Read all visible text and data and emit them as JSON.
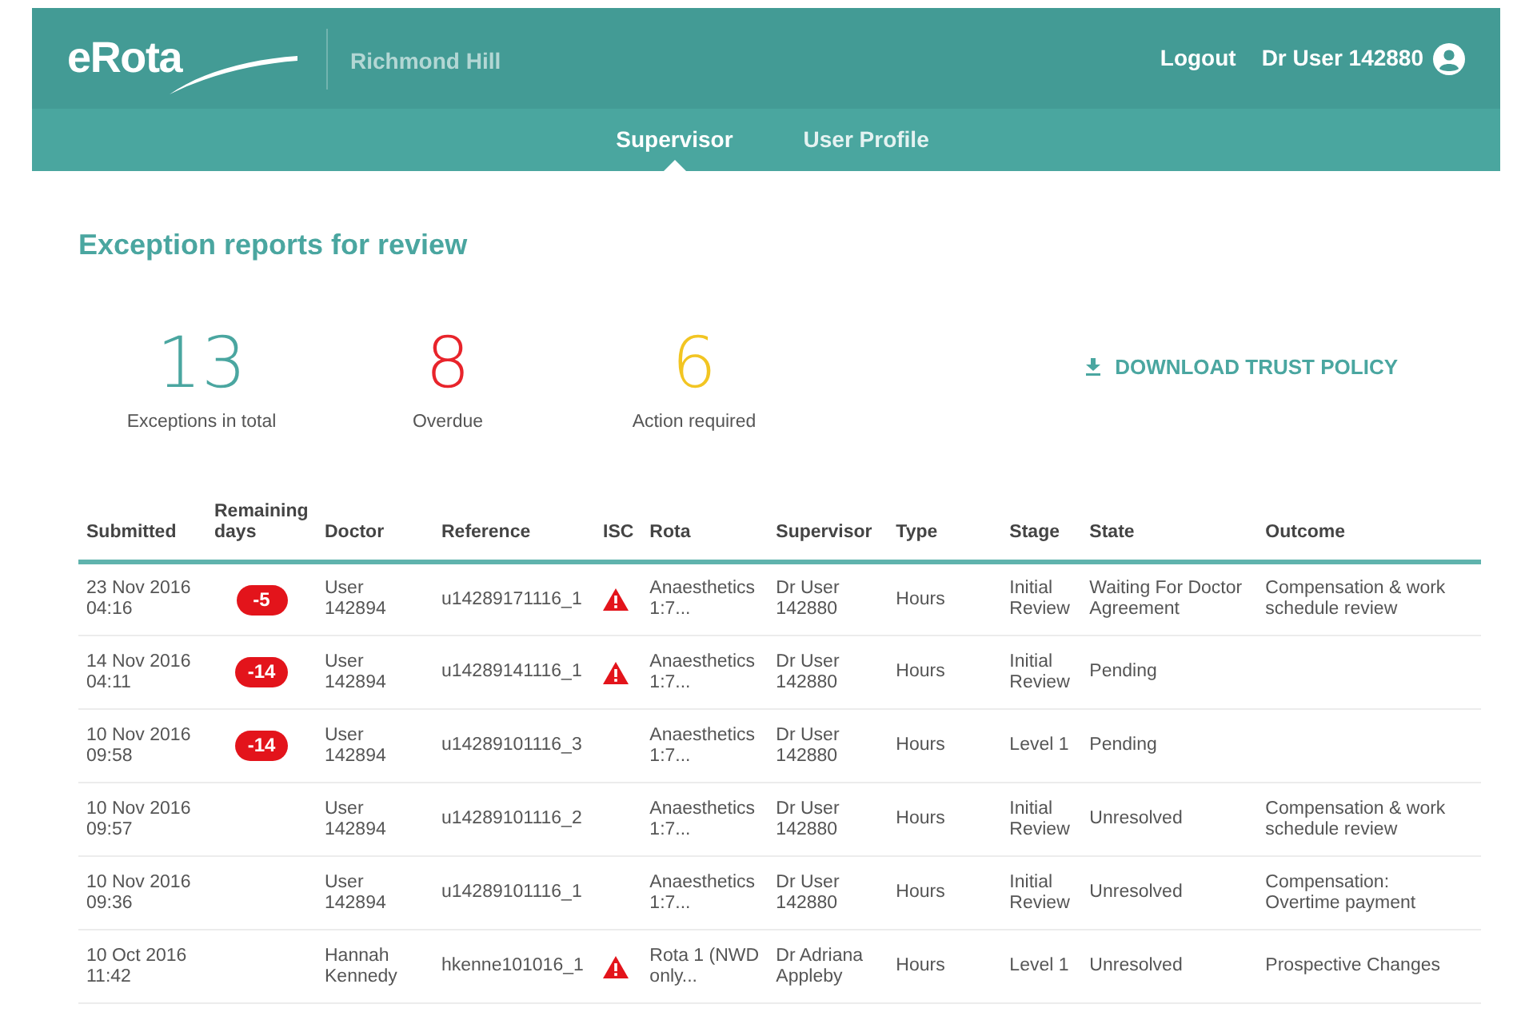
{
  "header": {
    "logo": "eRota",
    "site": "Richmond Hill",
    "logout": "Logout",
    "user": "Dr User 142880"
  },
  "tabs": [
    {
      "label": "Supervisor",
      "selected": true
    },
    {
      "label": "User Profile",
      "selected": false
    }
  ],
  "page_title": "Exception reports for review",
  "stats": [
    {
      "value": "13",
      "label": "Exceptions in total",
      "color": "#4aa6a0"
    },
    {
      "value": "8",
      "label": "Overdue",
      "color": "#e8242b"
    },
    {
      "value": "6",
      "label": "Action required",
      "color": "#f2c522"
    }
  ],
  "download": "DOWNLOAD TRUST POLICY",
  "table": {
    "columns": [
      "Submitted",
      "Remaining\ndays",
      "Doctor",
      "Reference",
      "ISC",
      "Rota",
      "Supervisor",
      "Type",
      "Stage",
      "State",
      "Outcome"
    ],
    "rows": [
      {
        "submitted": "23 Nov 2016\n04:16",
        "remaining": "-5",
        "doctor": "User\n142894",
        "reference": "u14289171116_1",
        "isc": true,
        "rota": "Anaesthetics\n1:7...",
        "supervisor": "Dr User\n142880",
        "type": "Hours",
        "stage": "Initial\nReview",
        "state": "Waiting For Doctor\nAgreement",
        "outcome": "Compensation & work\nschedule review"
      },
      {
        "submitted": "14 Nov 2016\n04:11",
        "remaining": "-14",
        "doctor": "User\n142894",
        "reference": "u14289141116_1",
        "isc": true,
        "rota": "Anaesthetics\n1:7...",
        "supervisor": "Dr User\n142880",
        "type": "Hours",
        "stage": "Initial\nReview",
        "state": "Pending"
      },
      {
        "submitted": "10 Nov 2016\n09:58",
        "remaining": "-14",
        "doctor": "User\n142894",
        "reference": "u14289101116_3",
        "isc": false,
        "rota": "Anaesthetics\n1:7...",
        "supervisor": "Dr User\n142880",
        "type": "Hours",
        "stage": "Level 1",
        "state": "Pending"
      },
      {
        "submitted": "10 Nov 2016\n09:57",
        "doctor": "User\n142894",
        "reference": "u14289101116_2",
        "isc": false,
        "rota": "Anaesthetics\n1:7...",
        "supervisor": "Dr User\n142880",
        "type": "Hours",
        "stage": "Initial\nReview",
        "state": "Unresolved",
        "outcome": "Compensation & work\nschedule review"
      },
      {
        "submitted": "10 Nov 2016\n09:36",
        "doctor": "User\n142894",
        "reference": "u14289101116_1",
        "isc": false,
        "rota": "Anaesthetics\n1:7...",
        "supervisor": "Dr User\n142880",
        "type": "Hours",
        "stage": "Initial\nReview",
        "state": "Unresolved",
        "outcome": "Compensation:\nOvertime payment"
      },
      {
        "submitted": "10 Oct 2016\n11:42",
        "doctor": "Hannah\nKennedy",
        "reference": "hkenne101016_1",
        "isc": true,
        "rota": "Rota 1 (NWD\nonly...",
        "supervisor": "Dr Adriana\nAppleby",
        "type": "Hours",
        "stage": "Level 1",
        "state": "Unresolved",
        "outcome": "Prospective Changes"
      }
    ]
  }
}
